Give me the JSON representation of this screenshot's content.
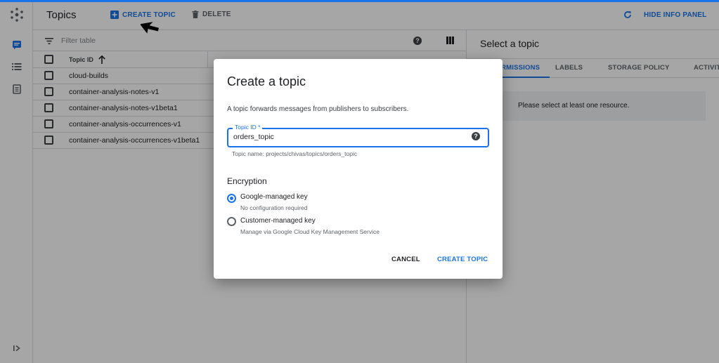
{
  "header": {
    "title": "Topics",
    "create_topic_label": "CREATE TOPIC",
    "delete_label": "DELETE",
    "hide_info_panel_label": "HIDE INFO PANEL"
  },
  "table": {
    "filter_placeholder": "Filter table",
    "columns": [
      "Topic ID"
    ],
    "rows": [
      "cloud-builds",
      "container-analysis-notes-v1",
      "container-analysis-notes-v1beta1",
      "container-analysis-occurrences-v1",
      "container-analysis-occurrences-v1beta1"
    ]
  },
  "info_panel": {
    "title": "Select a topic",
    "tabs": [
      "PERMISSIONS",
      "LABELS",
      "STORAGE POLICY",
      "ACTIVITY"
    ],
    "message": "Please select at least one resource."
  },
  "dialog": {
    "title": "Create a topic",
    "description": "A topic forwards messages from publishers to subscribers.",
    "topic_id_label": "Topic ID *",
    "topic_id_value": "orders_topic",
    "topic_name_hint": "Topic name: projects/chivas/topics/orders_topic",
    "encryption_title": "Encryption",
    "options": [
      {
        "label": "Google-managed key",
        "sub": "No configuration required",
        "selected": true
      },
      {
        "label": "Customer-managed key",
        "sub": "Manage via Google Cloud Key Management Service",
        "selected": false
      }
    ],
    "cancel_label": "CANCEL",
    "create_label": "CREATE TOPIC"
  },
  "colors": {
    "accent": "#1a73e8",
    "text": "#202124",
    "muted": "#5f6368"
  }
}
